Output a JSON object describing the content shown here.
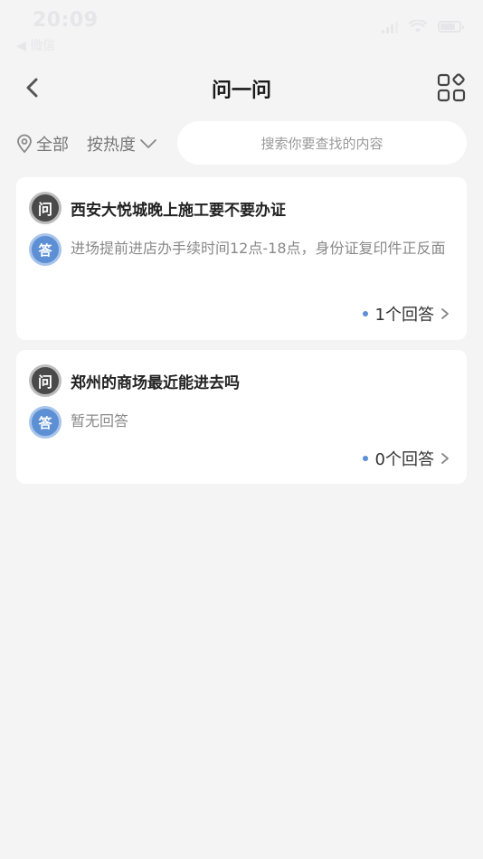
{
  "status": {
    "time": "20:09",
    "back_label": "◀ 微信"
  },
  "nav": {
    "title": "问一问"
  },
  "filter": {
    "location_label": "全部",
    "sort_label": "按热度",
    "search_placeholder": "搜索你要查找的内容"
  },
  "questions": [
    {
      "q_badge": "问",
      "question": "西安大悦城晚上施工要不要办证",
      "a_badge": "答",
      "answer": "进场提前进店办手续时间12点-18点，身份证复印件正反面",
      "answer_count": "1个回答"
    },
    {
      "q_badge": "问",
      "question": "郑州的商场最近能进去吗",
      "a_badge": "答",
      "answer": "暂无回答",
      "answer_count": "0个回答"
    }
  ],
  "colors": {
    "background": "#f4f4f5",
    "accent_blue": "#5c8fd4",
    "question_badge": "#4a4a4a"
  },
  "icons": {
    "back": "chevron-left-icon",
    "menu": "grid-apps-icon",
    "location": "location-pin-icon",
    "sort": "chevron-down-icon",
    "more": "chevron-right-icon"
  }
}
